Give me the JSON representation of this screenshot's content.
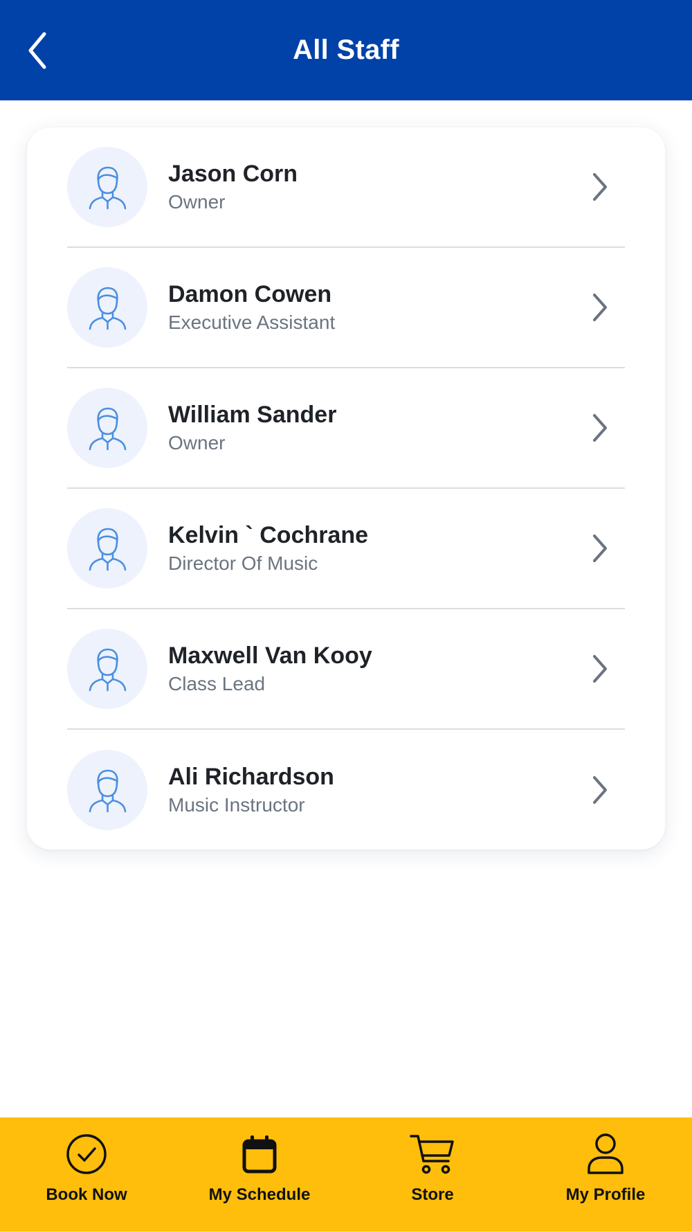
{
  "header": {
    "title": "All Staff",
    "back_icon": "chevron-left-icon"
  },
  "staff": [
    {
      "name": "Jason Corn",
      "role": "Owner"
    },
    {
      "name": "Damon Cowen",
      "role": "Executive Assistant"
    },
    {
      "name": "William Sander",
      "role": "Owner"
    },
    {
      "name": "Kelvin ` Cochrane",
      "role": "Director Of Music"
    },
    {
      "name": "Maxwell Van Kooy",
      "role": "Class Lead"
    },
    {
      "name": "Ali Richardson",
      "role": "Music Instructor"
    }
  ],
  "nav": {
    "items": [
      {
        "label": "Book Now",
        "icon": "check-circle-icon"
      },
      {
        "label": "My Schedule",
        "icon": "calendar-icon"
      },
      {
        "label": "Store",
        "icon": "cart-icon"
      },
      {
        "label": "My Profile",
        "icon": "user-icon"
      }
    ]
  },
  "colors": {
    "header_bg": "#0042A8",
    "nav_bg": "#FFBE0B",
    "avatar_bg": "#EEF2FC",
    "avatar_stroke": "#4A8FE0",
    "name_text": "#1F2328",
    "role_text": "#6A7480"
  }
}
